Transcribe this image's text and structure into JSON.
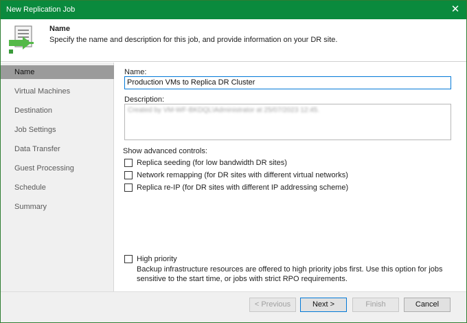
{
  "window": {
    "title": "New Replication Job",
    "close_glyph": "✕"
  },
  "header": {
    "title": "Name",
    "description": "Specify the name and description for this job, and provide information on your DR site.",
    "icon": "replication-job-icon"
  },
  "sidebar": {
    "items": [
      {
        "label": "Name",
        "active": true
      },
      {
        "label": "Virtual Machines",
        "active": false
      },
      {
        "label": "Destination",
        "active": false
      },
      {
        "label": "Job Settings",
        "active": false
      },
      {
        "label": "Data Transfer",
        "active": false
      },
      {
        "label": "Guest Processing",
        "active": false
      },
      {
        "label": "Schedule",
        "active": false
      },
      {
        "label": "Summary",
        "active": false
      }
    ]
  },
  "form": {
    "name_label": "Name:",
    "name_value": "Production VMs to Replica DR Cluster",
    "description_label": "Description:",
    "description_value": "Created by VM-WF-BKDQL\\Administrator at 25/07/2023 12:45.",
    "advanced_label": "Show advanced controls:",
    "options": [
      {
        "label": "Replica seeding (for low bandwidth DR sites)",
        "checked": false
      },
      {
        "label": "Network remapping (for DR sites with different virtual networks)",
        "checked": false
      },
      {
        "label": "Replica re-IP (for DR sites with different IP addressing scheme)",
        "checked": false
      }
    ],
    "high_priority": {
      "label": "High priority",
      "checked": false,
      "description_line1": "Backup infrastructure resources are offered to high priority jobs first. Use this option for jobs",
      "description_line2": "sensitive to the start time, or jobs with strict RPO requirements."
    }
  },
  "footer": {
    "previous": "< Previous",
    "next": "Next >",
    "finish": "Finish",
    "cancel": "Cancel"
  },
  "colors": {
    "titlebar": "#0a8a3d",
    "accent": "#0078d7",
    "nav_active": "#9b9b9b"
  }
}
